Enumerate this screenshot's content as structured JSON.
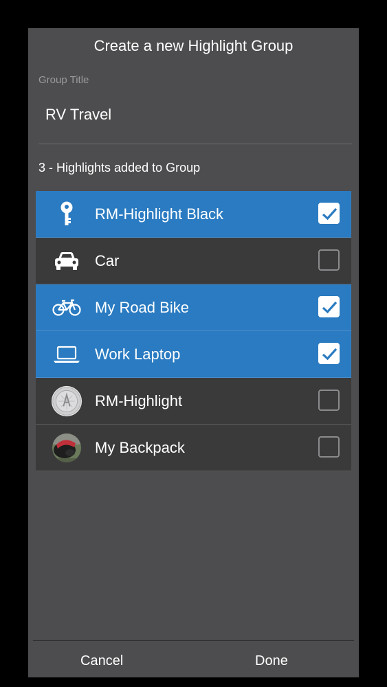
{
  "dialog": {
    "title": "Create a new Highlight Group",
    "group_title_label": "Group Title",
    "group_title_value": "RV Travel",
    "count_text": "3 - Highlights added to Group"
  },
  "items": [
    {
      "label": "RM-Highlight Black",
      "icon": "key-icon",
      "checked": true
    },
    {
      "label": "Car",
      "icon": "car-icon",
      "checked": false
    },
    {
      "label": "My Road Bike",
      "icon": "bicycle-icon",
      "checked": true
    },
    {
      "label": "Work Laptop",
      "icon": "laptop-icon",
      "checked": true
    },
    {
      "label": "RM-Highlight",
      "icon": "highlight-device-icon",
      "checked": false
    },
    {
      "label": "My Backpack",
      "icon": "backpack-photo-icon",
      "checked": false
    }
  ],
  "footer": {
    "cancel_label": "Cancel",
    "done_label": "Done"
  },
  "colors": {
    "selected_row": "#2a7bc1",
    "unselected_row": "#3a3a3b",
    "dialog_bg": "#4d4d4f"
  }
}
